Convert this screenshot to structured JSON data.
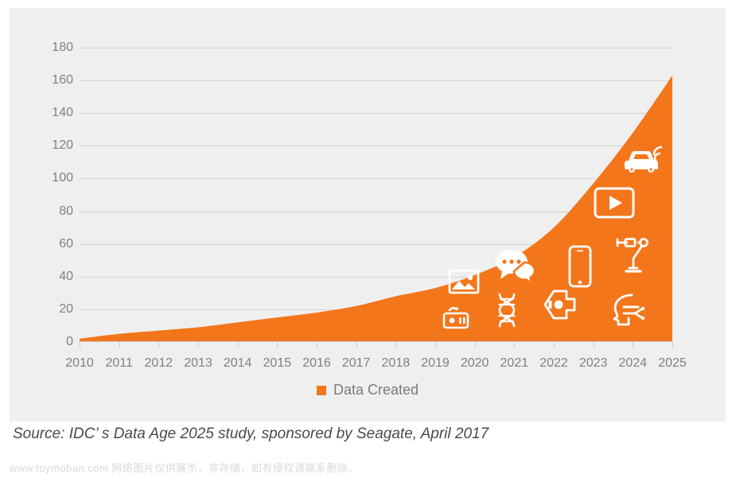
{
  "chart_data": {
    "type": "area",
    "title": "",
    "xlabel": "",
    "ylabel": "",
    "grid": true,
    "legend_position": "bottom",
    "xlim": [
      2010,
      2025
    ],
    "ylim": [
      0,
      180
    ],
    "y_ticks": [
      0,
      20,
      40,
      60,
      80,
      100,
      120,
      140,
      160,
      180
    ],
    "categories": [
      "2010",
      "2011",
      "2012",
      "2013",
      "2014",
      "2015",
      "2016",
      "2017",
      "2018",
      "2019",
      "2020",
      "2021",
      "2022",
      "2023",
      "2024",
      "2025"
    ],
    "series": [
      {
        "name": "Data Created",
        "color": "#f4761b",
        "values": [
          2,
          5,
          7,
          9,
          12,
          15,
          18,
          22,
          28,
          33,
          41,
          52,
          70,
          97,
          128,
          163
        ]
      }
    ]
  },
  "legend": {
    "entries": [
      {
        "label": "Data Created",
        "color": "#f4761b",
        "marker": "square"
      }
    ]
  },
  "icons": [
    {
      "name": "camera-recorder-icon",
      "label": "Media capture device"
    },
    {
      "name": "photo-image-icon",
      "label": "Images"
    },
    {
      "name": "dna-helix-icon",
      "label": "Genomics data"
    },
    {
      "name": "chat-bubbles-icon",
      "label": "Messaging"
    },
    {
      "name": "security-camera-icon",
      "label": "Surveillance"
    },
    {
      "name": "smartphone-icon",
      "label": "Mobile devices"
    },
    {
      "name": "video-player-icon",
      "label": "Video streaming"
    },
    {
      "name": "robot-arm-icon",
      "label": "Industrial automation"
    },
    {
      "name": "ai-head-icon",
      "label": "Artificial intelligence"
    },
    {
      "name": "connected-car-icon",
      "label": "Connected vehicles"
    }
  ],
  "footer": {
    "source": "Source: IDC’ s Data Age 2025 study, sponsored by Seagate, April 2017",
    "watermark": "www.toymoban.com 网络图片仅供展示，非存储，如有侵权请联系删除。"
  },
  "colors": {
    "accent": "#f4761b",
    "panel": "#efefef",
    "grid": "#d4d4d4",
    "tick_text": "#808080",
    "source_text": "#4a4a4a"
  }
}
